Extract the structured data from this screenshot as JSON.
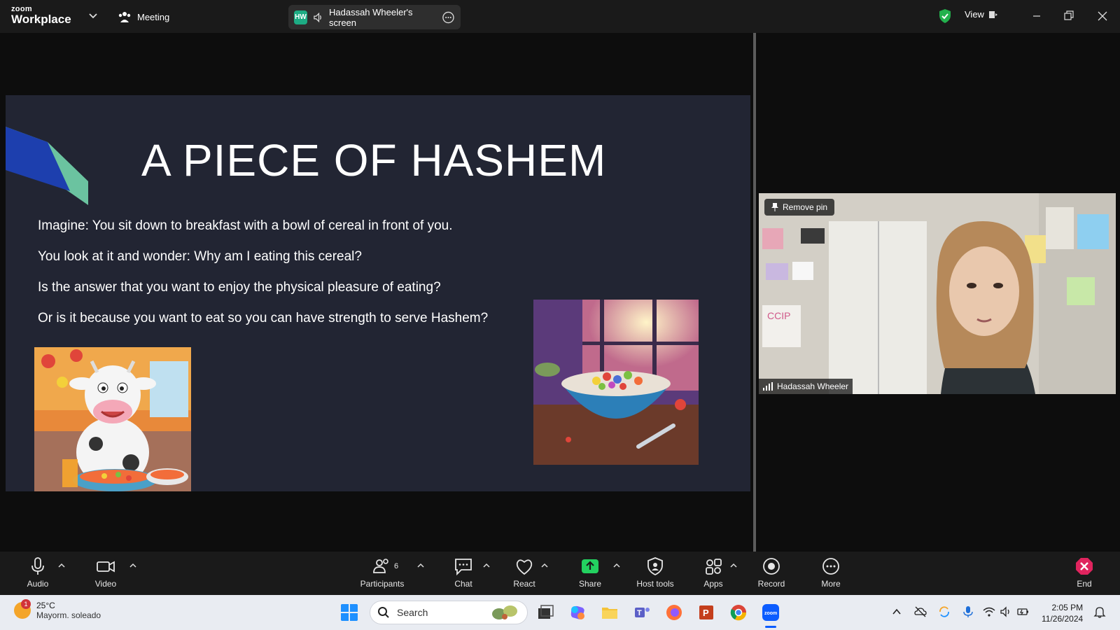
{
  "titlebar": {
    "logo_small": "zoom",
    "logo_big": "Workplace",
    "meeting_label": "Meeting",
    "share_badge": "HW",
    "share_label": "Hadassah Wheeler's screen",
    "view_label": "View"
  },
  "slide": {
    "title": "A PIECE OF HASHEM",
    "lines": [
      "Imagine: You sit down to breakfast with a bowl of cereal in front of you.",
      "You look at it and wonder: Why am I eating this cereal?",
      "Is the answer that you want to enjoy the physical pleasure of eating?",
      "Or is it because you want to eat so you can have strength to serve Hashem?"
    ]
  },
  "video": {
    "remove_pin": "Remove pin",
    "participant_name": "Hadassah Wheeler"
  },
  "toolbar": {
    "audio": "Audio",
    "video": "Video",
    "participants": "Participants",
    "participants_count": "6",
    "chat": "Chat",
    "react": "React",
    "share": "Share",
    "host_tools": "Host tools",
    "apps": "Apps",
    "record": "Record",
    "more": "More",
    "end": "End"
  },
  "taskbar": {
    "weather_badge": "1",
    "temperature": "25°C",
    "weather_desc": "Mayorm. soleado",
    "search_placeholder": "Search",
    "time": "2:05 PM",
    "date": "11/26/2024"
  },
  "colors": {
    "accent_green": "#1dac84",
    "share_green": "#23d160",
    "end_red": "#e0245e",
    "slide_bg": "#222533"
  }
}
